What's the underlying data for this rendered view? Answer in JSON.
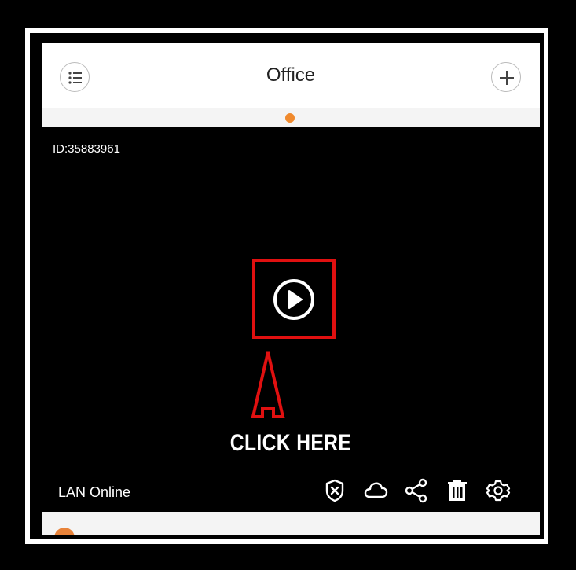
{
  "header": {
    "title": "Office",
    "menu_icon": "list-icon",
    "add_icon": "plus-icon"
  },
  "pager": {
    "active_color": "#f08a2e"
  },
  "camera": {
    "id_label": "ID:35883961",
    "status": "LAN Online",
    "play_icon": "play-circle-icon"
  },
  "annotation": {
    "label": "CLICK HERE",
    "highlight_color": "#e01010"
  },
  "toolbar": {
    "icons": [
      "shield-x-icon",
      "cloud-icon",
      "share-icon",
      "trash-icon",
      "settings-gear-icon"
    ]
  }
}
